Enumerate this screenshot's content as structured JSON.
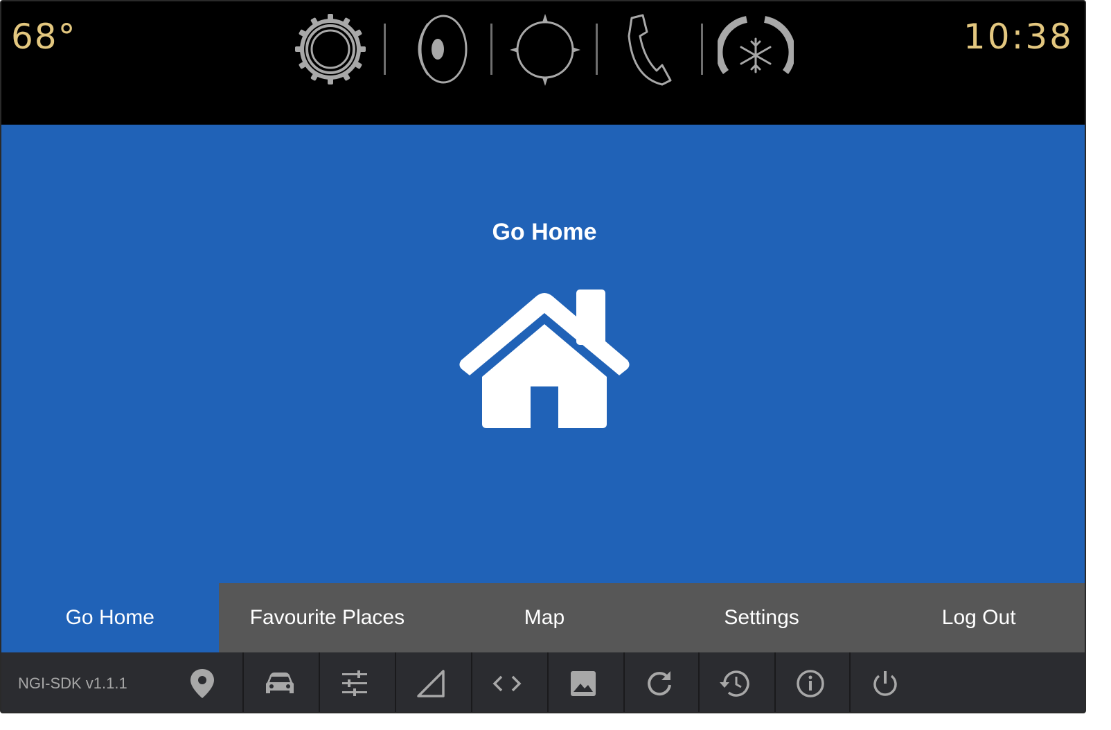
{
  "status_bar": {
    "temperature": "68°",
    "time": "10:38",
    "icons": [
      "gear-icon",
      "speaker-icon",
      "compass-icon",
      "phone-icon",
      "climate-fan-icon"
    ]
  },
  "main": {
    "title": "Go Home",
    "icon": "house-icon",
    "background": "#2062b7"
  },
  "tabs": [
    {
      "label": "Go Home",
      "active": true
    },
    {
      "label": "Favourite Places",
      "active": false
    },
    {
      "label": "Map",
      "active": false
    },
    {
      "label": "Settings",
      "active": false
    },
    {
      "label": "Log Out",
      "active": false
    }
  ],
  "toolbar": {
    "version": "NGI-SDK v1.1.1",
    "icons": [
      "location-pin-icon",
      "car-icon",
      "sliders-icon",
      "signal-icon",
      "code-icon",
      "image-icon",
      "refresh-icon",
      "history-icon",
      "info-icon",
      "power-icon"
    ]
  },
  "colors": {
    "accent_text": "#e3c77f",
    "main_blue": "#2062b7",
    "tab_bar": "#575757",
    "toolbar": "#2b2c30"
  }
}
